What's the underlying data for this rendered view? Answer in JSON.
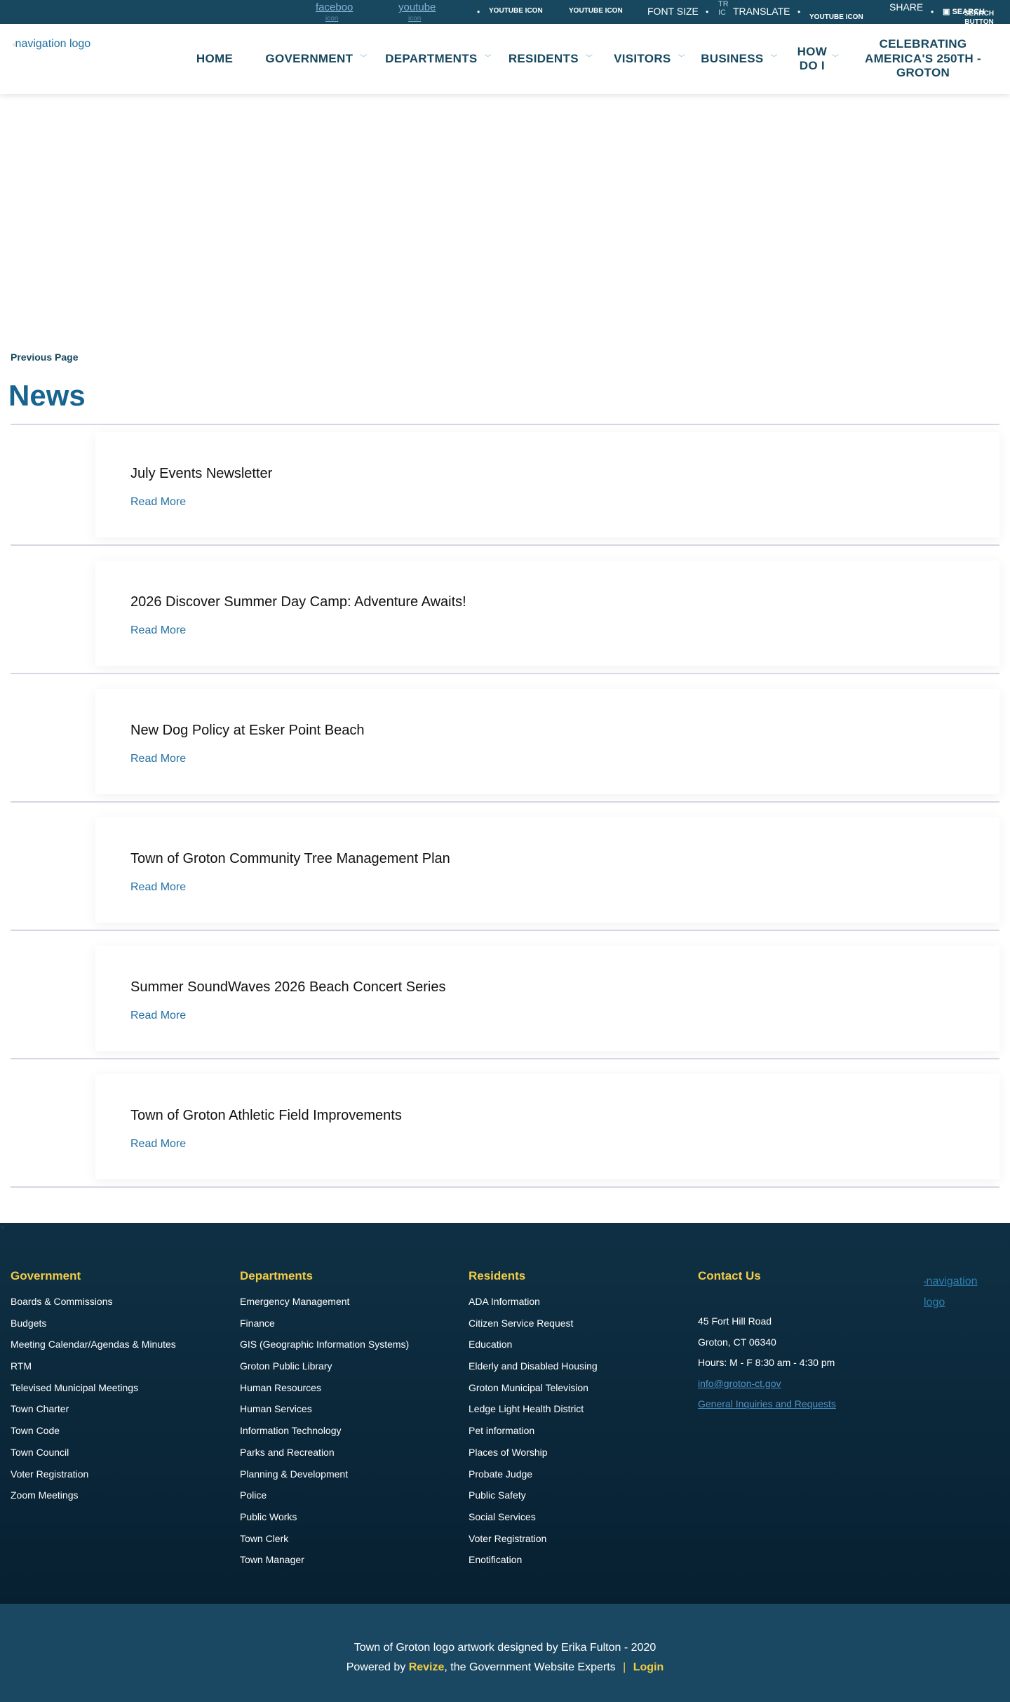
{
  "topbar": {
    "facebook": {
      "label": "faceboo",
      "sub": "icon"
    },
    "youtube": {
      "label": "youtube",
      "sub": "icon"
    },
    "youtube_icon_1": "YOUTUBE ICON",
    "youtube_icon_2": "YOUTUBE ICON",
    "font_size": "FONT SIZE",
    "translate_icon": "TR IC",
    "translate": "TRANSLATE",
    "youtube_icon_3": "YOUTUBE ICON",
    "share": "SHARE",
    "search_icon": "SEARCH",
    "search_button": "SEARCH BUTTON"
  },
  "header": {
    "logo_alt": "navigation logo",
    "nav": [
      {
        "label": "HOME"
      },
      {
        "label": "GOVERNMENT"
      },
      {
        "label": "DEPARTMENTS"
      },
      {
        "label": "RESIDENTS"
      },
      {
        "label": "VISITORS"
      },
      {
        "label": "BUSINESS"
      },
      {
        "label": "HOW DO I"
      },
      {
        "label": "CELEBRATING AMERICA'S 250TH - GROTON"
      }
    ]
  },
  "main": {
    "previous_page": "Previous Page",
    "title": "News",
    "read_more": "Read More",
    "news": [
      {
        "title": "July Events Newsletter"
      },
      {
        "title": "2026 Discover Summer Day Camp: Adventure Awaits!"
      },
      {
        "title": "New Dog Policy at Esker Point Beach"
      },
      {
        "title": "Town of Groton Community Tree Management Plan"
      },
      {
        "title": "Summer SoundWaves 2026 Beach Concert Series"
      },
      {
        "title": "Town of Groton Athletic Field Improvements"
      }
    ]
  },
  "footer": {
    "government": {
      "heading": "Government",
      "links": [
        "Boards & Commissions",
        "Budgets",
        "Meeting Calendar/Agendas & Minutes",
        "RTM",
        "Televised Municipal Meetings",
        "Town Charter",
        "Town Code",
        "Town Council",
        "Voter Registration",
        "Zoom Meetings"
      ]
    },
    "departments": {
      "heading": "Departments",
      "links": [
        "Emergency Management",
        "Finance",
        "GIS (Geographic Information Systems)",
        "Groton Public Library",
        "Human Resources",
        "Human Services",
        "Information Technology",
        "Parks and Recreation",
        "Planning & Development",
        "Police",
        "Public Works",
        "Town Clerk",
        "Town Manager"
      ]
    },
    "residents": {
      "heading": "Residents",
      "links": [
        "ADA Information",
        "Citizen Service Request",
        "Education",
        "Elderly and Disabled Housing",
        "Groton Municipal Television",
        "Ledge Light Health District",
        "Pet information",
        "Places of Worship",
        "Probate Judge",
        "Public Safety",
        "Social Services",
        "Voter Registration",
        "Enotification"
      ]
    },
    "contact": {
      "heading": "Contact Us",
      "address1": "45 Fort Hill Road",
      "address2": "Groton, CT 06340",
      "hours": "Hours: M - F 8:30 am - 4:30 pm",
      "email": "info@groton-ct.gov",
      "inquiries": "General Inquiries and Requests"
    },
    "logo_alt": "navigation logo"
  },
  "bottom": {
    "credit": "Town of Groton logo artwork designed by Erika Fulton - 2020",
    "powered_prefix": "Powered by",
    "revize": "Revize",
    "powered_suffix": ", the Government Website Experts",
    "separator": "|",
    "login": "Login"
  }
}
